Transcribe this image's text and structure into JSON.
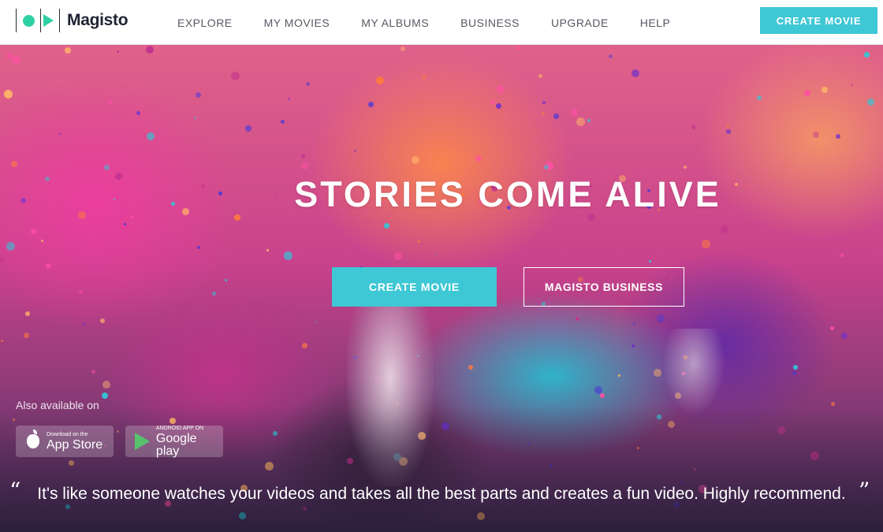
{
  "brand": {
    "name": "Magisto",
    "accent": "#3ec7d4",
    "logo_green": "#2fd1a4"
  },
  "nav": {
    "items": [
      "EXPLORE",
      "MY MOVIES",
      "MY ALBUMS",
      "BUSINESS",
      "UPGRADE",
      "HELP"
    ],
    "cta": "CREATE MOVIE"
  },
  "hero": {
    "headline": "STORIES COME ALIVE",
    "primary_button": "CREATE MOVIE",
    "secondary_button": "MAGISTO BUSINESS"
  },
  "apps": {
    "label": "Also available on",
    "app_store": {
      "small": "Download on the",
      "big": "App Store",
      "icon": "apple-icon"
    },
    "google_play": {
      "small": "ANDROID APP ON",
      "big": "Google play",
      "icon": "google-play-icon"
    }
  },
  "testimonial": {
    "open_quote": "“",
    "text": "It's like someone watches your videos and takes all the best parts and creates a fun video. Highly recommend.",
    "close_quote": "”"
  }
}
